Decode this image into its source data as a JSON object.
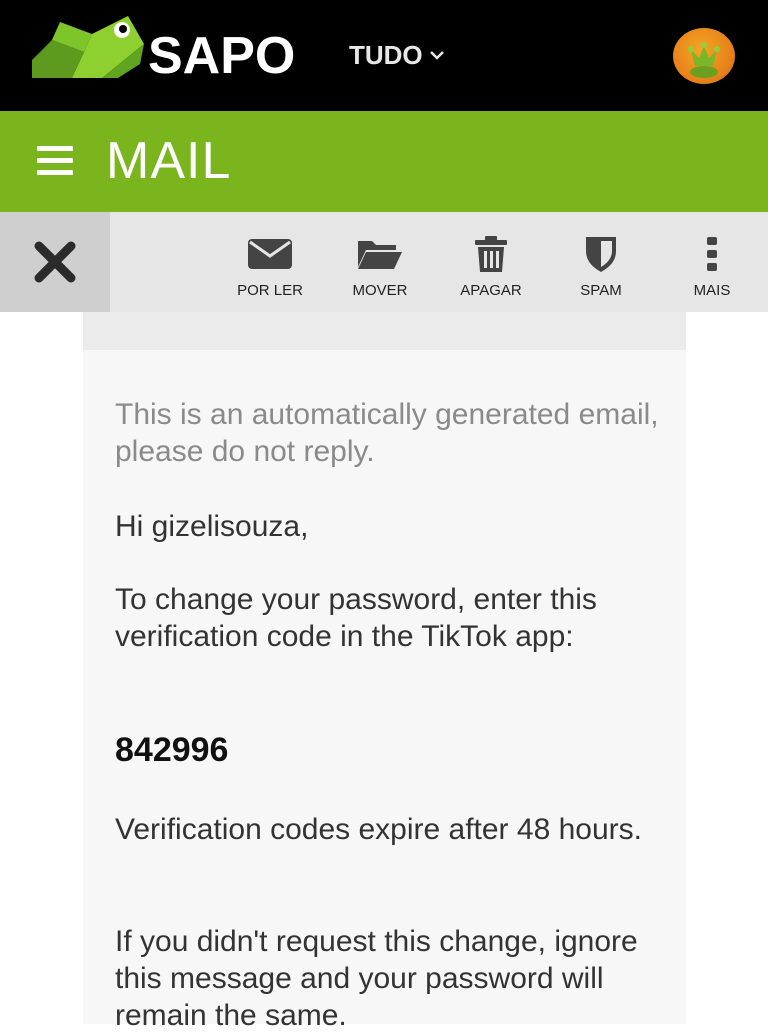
{
  "header": {
    "logo_text": "SAPO",
    "menu_label": "TUDO"
  },
  "app": {
    "title": "MAIL"
  },
  "toolbar": {
    "close_icon": "close-icon",
    "buttons": [
      {
        "label": "POR LER",
        "icon": "envelope-icon"
      },
      {
        "label": "MOVER",
        "icon": "folder-open-icon"
      },
      {
        "label": "APAGAR",
        "icon": "trash-icon"
      },
      {
        "label": "SPAM",
        "icon": "shield-icon"
      },
      {
        "label": "MAIS",
        "icon": "more-vertical-icon"
      }
    ]
  },
  "email": {
    "notice": "This is an automatically generated email, please do not reply.",
    "greeting": "Hi gizelisouza,",
    "instruction": "To change your password, enter this verification code in the TikTok app:",
    "code": "842996",
    "expiry": "Verification codes expire after 48 hours.",
    "ignore": "If you didn't request this change, ignore this message and your password will remain the same."
  },
  "colors": {
    "topbar": "#000000",
    "brand_green": "#7ab51d",
    "toolbar_bg": "#e6e6e6",
    "card_bg": "#f7f7f7"
  }
}
